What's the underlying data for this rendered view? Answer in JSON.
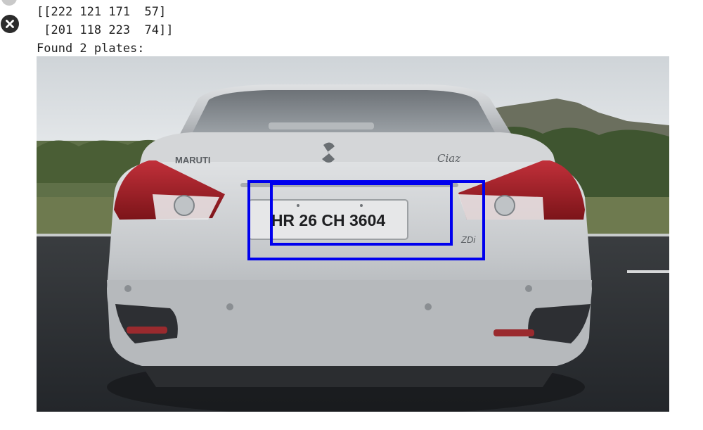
{
  "output": {
    "lines": [
      "[[222 121 171  57]",
      " [201 118 223  74]]",
      "Found 2 plates:"
    ],
    "clear_button_icon": "close-circle-icon"
  },
  "image": {
    "plate_text": "HR 26 CH 3604",
    "badge_text": "Ciaz",
    "variant_text": "ZDi",
    "box_color": "#0000ee",
    "plates_detected": 2
  }
}
